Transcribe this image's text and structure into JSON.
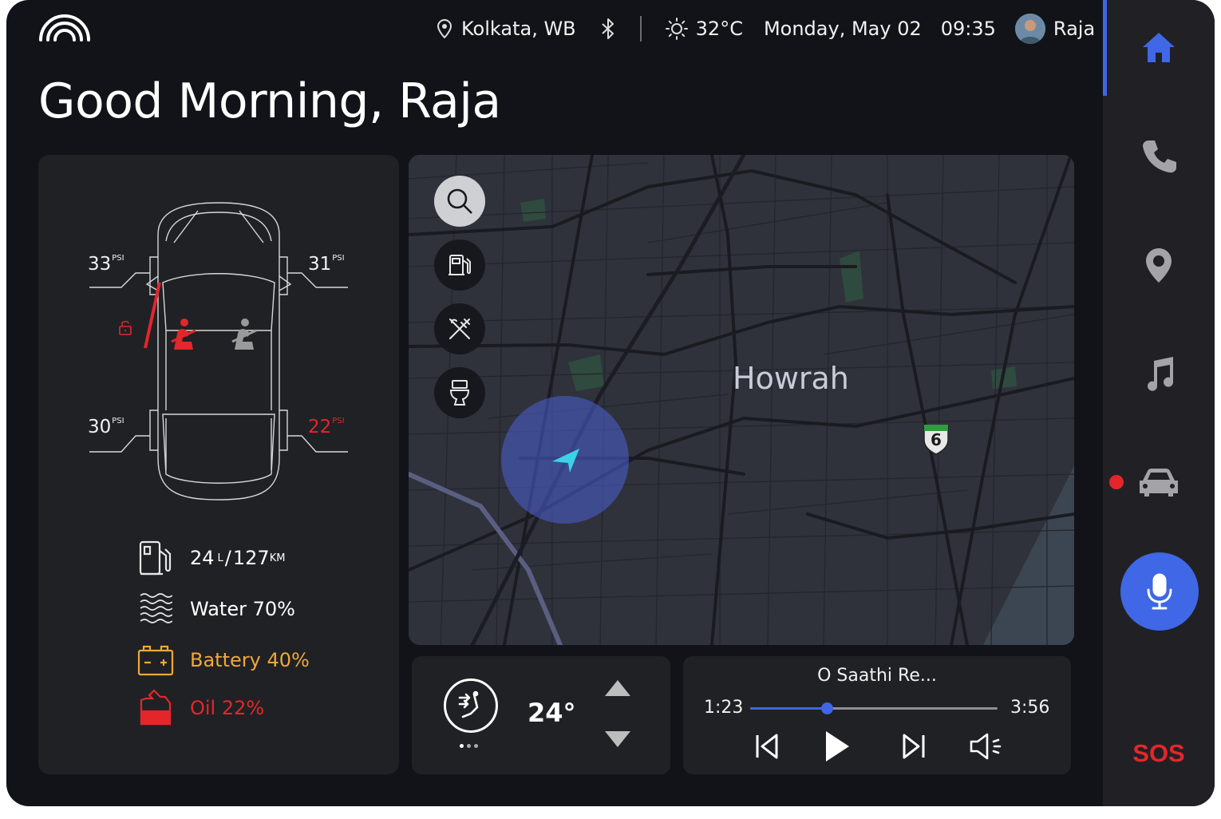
{
  "header": {
    "location": "Kolkata, WB",
    "weather": "32°C",
    "date": "Monday, May 02",
    "time": "09:35",
    "user": "Raja"
  },
  "greeting": "Good Morning, Raja",
  "vehicle": {
    "tires": {
      "front_left": "33",
      "front_right": "31",
      "rear_left": "30",
      "rear_right": "22",
      "unit": "PSI"
    },
    "fuel": {
      "amount": "24",
      "amount_unit": "L",
      "separator": "/",
      "range": "127",
      "range_unit": "KM"
    },
    "water": "Water 70%",
    "battery": "Battery 40%",
    "oil": "Oil 22%"
  },
  "map": {
    "area_label": "Howrah",
    "highway_number": "6"
  },
  "climate": {
    "temperature": "24°"
  },
  "media": {
    "song_title": "O Saathi Re...",
    "elapsed": "1:23",
    "duration": "3:56",
    "progress": 0.31
  },
  "sidebar": {
    "sos_label": "SOS"
  },
  "colors": {
    "accent": "#3f67e6",
    "alert": "#e4262b",
    "warning": "#f0a73a",
    "background": "#121318",
    "panel": "#202124"
  }
}
